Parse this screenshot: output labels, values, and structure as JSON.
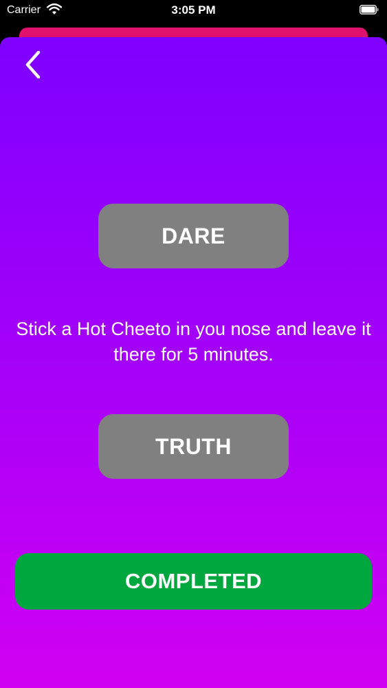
{
  "status_bar": {
    "carrier": "Carrier",
    "time": "3:05 PM",
    "wifi_icon": "wifi-icon",
    "battery_icon": "battery-icon"
  },
  "nav": {
    "back_icon": "chevron-left-icon"
  },
  "buttons": {
    "dare_label": "DARE",
    "truth_label": "TRUTH",
    "completed_label": "COMPLETED"
  },
  "prompt": {
    "text": "Stick a Hot Cheeto in you nose and leave it there for 5 minutes."
  },
  "colors": {
    "gradient_top": "#7e00ff",
    "gradient_bottom": "#d100f2",
    "button_gray": "#808080",
    "completed_green": "#00a63e",
    "card_pink": "#e0116c"
  }
}
